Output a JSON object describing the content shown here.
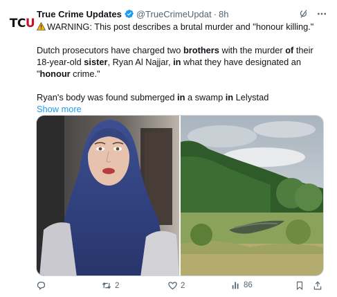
{
  "tweet": {
    "avatar_text": "TCU",
    "display_name": "True Crime Updates",
    "handle": "@TrueCrimeUpdat",
    "separator": "·",
    "timestamp": "8h",
    "warning_text": "WARNING: This post describes a brutal murder and \"honour killing.\"",
    "para1": {
      "t1": "Dutch prosecutors have charged two ",
      "b1": "brothers",
      "t2": " with the murder ",
      "b2": "of",
      "t3": " their 18-year-old ",
      "b3": "sister",
      "t4": ", Ryan Al Najjar, ",
      "b4": "in",
      "t5": " what they have designated an \"",
      "b5": "honour",
      "t6": " crime.\""
    },
    "para2": {
      "t1": "Ryan's body was found submerged ",
      "b1": "in",
      "t2": " a swamp ",
      "b2": "in",
      "t3": " Lelystad"
    },
    "show_more": "Show more"
  },
  "media": {
    "left_image": "selfie of young woman in blue hijab",
    "right_image": "swamp with trees under overcast sky"
  },
  "actions": {
    "replies": "",
    "reposts": "2",
    "likes": "2",
    "views": "86"
  },
  "colors": {
    "accent": "#1d9bf0",
    "text": "#0f1419",
    "muted": "#536471",
    "brand_red": "#c8102e"
  },
  "icons": [
    "verified-badge-icon",
    "grok-icon",
    "more-icon",
    "warning-icon",
    "reply-icon",
    "repost-icon",
    "like-icon",
    "views-icon",
    "bookmark-icon",
    "share-icon"
  ]
}
